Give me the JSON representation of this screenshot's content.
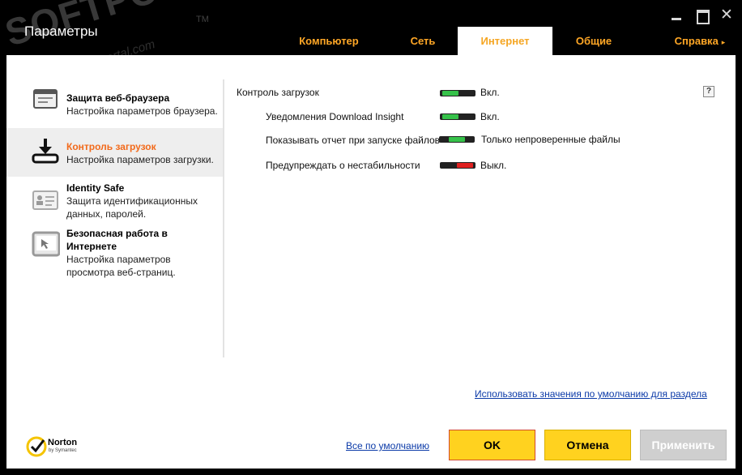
{
  "window": {
    "title": "Параметры",
    "controls": [
      "minimize-icon",
      "maximize-icon",
      "close-icon"
    ]
  },
  "watermark": {
    "text": "SOFTPORTAL",
    "tm": "TM",
    "url": "www.softportal.com"
  },
  "tabs": [
    {
      "label": "Компьютер",
      "active": false
    },
    {
      "label": "Сеть",
      "active": false
    },
    {
      "label": "Интернет",
      "active": true
    },
    {
      "label": "Общие",
      "active": false
    },
    {
      "label": "Справка",
      "active": false,
      "arrow": "▸"
    }
  ],
  "sidebar": {
    "items": [
      {
        "title": "Защита веб-браузера",
        "desc": [
          "Настройка параметров браузера."
        ],
        "icon": "browser-shield-icon",
        "active": false
      },
      {
        "title": "Контроль загрузок",
        "desc": [
          "Настройка параметров загрузки."
        ],
        "icon": "download-icon",
        "active": true
      },
      {
        "title": "Identity Safe",
        "desc": [
          "Защита идентификационных",
          "данных, паролей."
        ],
        "icon": "id-card-icon",
        "active": false
      },
      {
        "title": [
          "Безопасная работа в",
          "Интернете"
        ],
        "desc": [
          "Настройка параметров",
          "просмотра веб-страниц."
        ],
        "icon": "safe-web-icon",
        "active": false
      }
    ]
  },
  "settings": {
    "help_label": "?",
    "rows": [
      {
        "label": "Контроль загрузок",
        "state": "on",
        "value": "Вкл."
      },
      {
        "label": "Уведомления Download Insight",
        "state": "on",
        "value": "Вкл."
      },
      {
        "label": "Показывать отчет при запуске файлов",
        "state": "mid",
        "value": "Только непроверенные файлы"
      },
      {
        "label": "Предупреждать о нестабильности",
        "state": "off",
        "value": "Выкл."
      }
    ]
  },
  "links": {
    "section_defaults": "Использовать значения по умолчанию для раздела",
    "all_defaults": "Все по умолчанию"
  },
  "buttons": {
    "ok": "OK",
    "cancel": "Отмена",
    "apply": "Применить"
  },
  "brand": {
    "name": "Norton",
    "sub": "by Symantec"
  },
  "colors": {
    "accent": "#ffa726",
    "active_item": "#f26a1b",
    "toggle_on": "#36c24a",
    "toggle_off": "#e02020",
    "button": "#ffd21f"
  }
}
